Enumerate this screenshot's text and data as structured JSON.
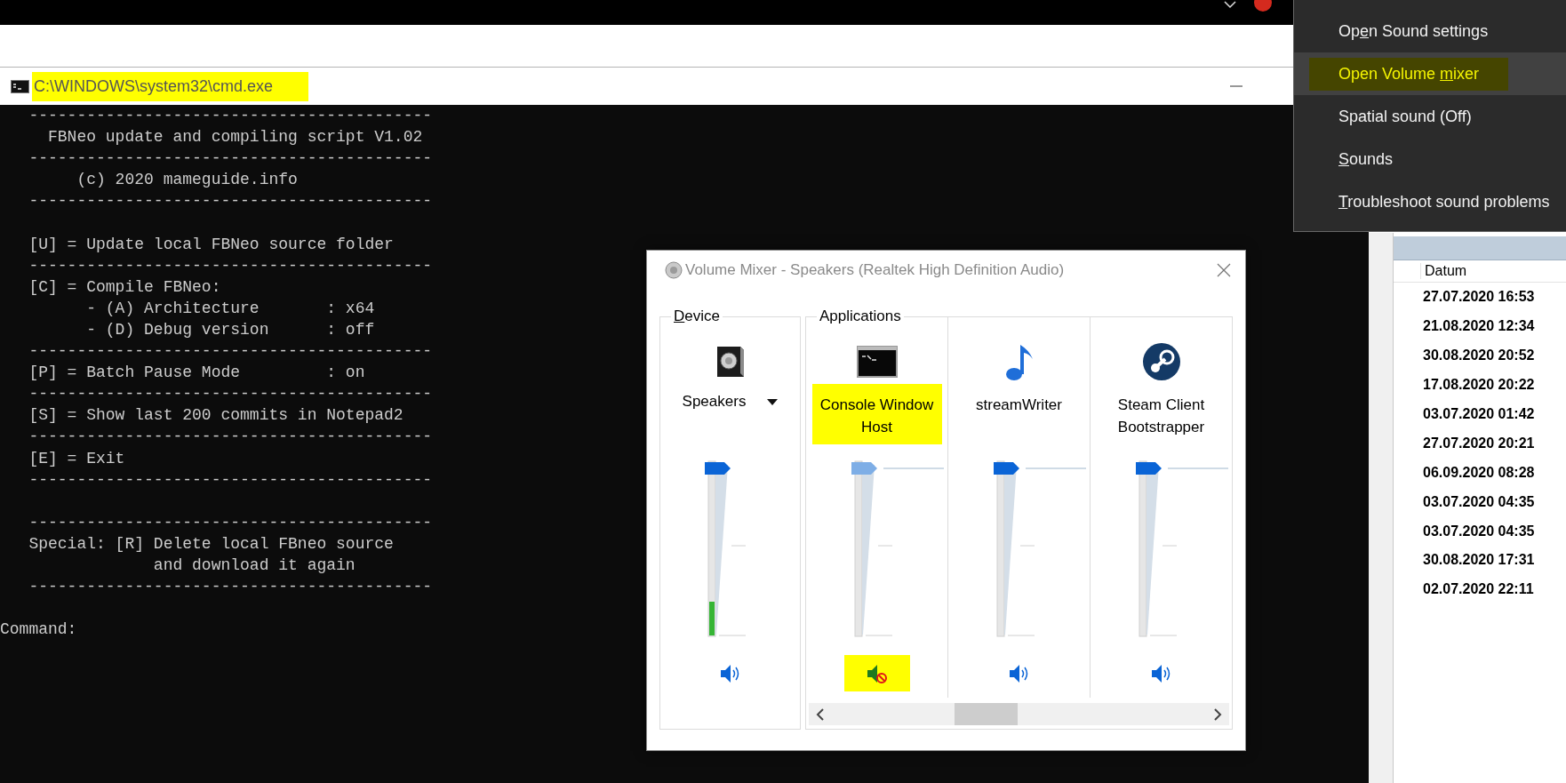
{
  "cmd_window": {
    "title": "C:\\WINDOWS\\system32\\cmd.exe",
    "title_marked": true,
    "blocks": [
      [
        "   ------------------------------------------",
        "     FBNeo update and compiling script V1.02",
        "   ------------------------------------------",
        "        (c) 2020 mameguide.info",
        "   ------------------------------------------"
      ],
      [
        "   [U] = Update local FBNeo source folder",
        "   ------------------------------------------",
        "   [C] = Compile FBNeo:",
        "         - (A) Architecture       : x64",
        "         - (D) Debug version      : off",
        "   ------------------------------------------",
        "   [P] = Batch Pause Mode         : on",
        "   ------------------------------------------",
        "   [S] = Show last 200 commits in Notepad2",
        "   ------------------------------------------",
        "   [E] = Exit",
        "   ------------------------------------------"
      ],
      [
        "   ------------------------------------------",
        "   Special: [R] Delete local FBneo source",
        "                and download it again",
        "   ------------------------------------------"
      ],
      [
        "Command:"
      ]
    ]
  },
  "sound_menu": {
    "items": [
      {
        "before": "Op",
        "key": "e",
        "after": "n Sound settings",
        "selected": false,
        "marked": false
      },
      {
        "before": "Open Volume ",
        "key": "m",
        "after": "ixer",
        "selected": true,
        "marked": true
      },
      {
        "before": "Spatial sound (Off)",
        "selected": false,
        "marked": false
      },
      {
        "key": "S",
        "after": "ounds",
        "selected": false,
        "marked": false
      },
      {
        "key": "T",
        "after": "roubleshoot sound problems",
        "selected": false,
        "marked": false
      }
    ]
  },
  "volume_mixer": {
    "title": "Volume Mixer - Speakers (Realtek High Definition Audio)",
    "device_label": {
      "key": "D",
      "after": "evice"
    },
    "device": {
      "name": "Speakers",
      "volume": {
        "level": 1
      },
      "meter": {
        "level": 0.2
      },
      "muted": false
    },
    "applications_label": "Applications",
    "apps": [
      {
        "name": "Console Window Host",
        "kind": "console",
        "marked": true,
        "mute_marked": true,
        "volume": {
          "level": 1
        },
        "muted": true
      },
      {
        "name": "streamWriter",
        "kind": "note",
        "marked": false,
        "mute_marked": false,
        "volume": {
          "level": 1
        },
        "muted": false
      },
      {
        "name": "Steam Client Bootstrapper",
        "kind": "logo",
        "marked": false,
        "mute_marked": false,
        "volume": {
          "level": 1
        },
        "muted": false
      }
    ]
  },
  "list_panel": {
    "columns": [
      "Datum"
    ],
    "rows": [
      "27.07.2020 16:53",
      "21.08.2020 12:34",
      "30.08.2020 20:52",
      "17.08.2020 20:22",
      "03.07.2020 01:42",
      "27.07.2020 20:21",
      "06.09.2020 08:28",
      "03.07.2020 04:35",
      "03.07.2020 04:35",
      "30.08.2020 17:31",
      "02.07.2020 22:11"
    ]
  }
}
